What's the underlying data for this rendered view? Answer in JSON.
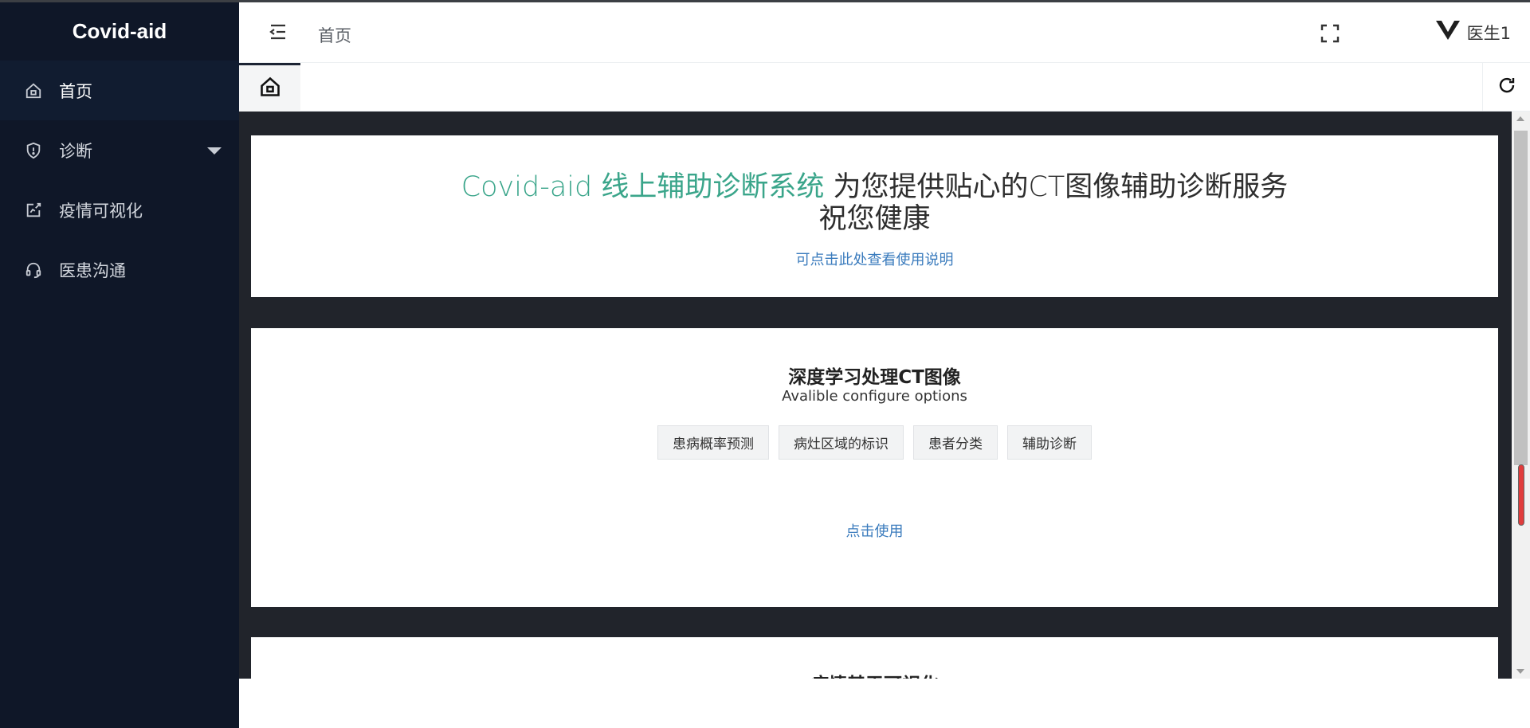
{
  "app": {
    "brand": "Covid-aid"
  },
  "sidebar": {
    "items": [
      {
        "label": "首页",
        "icon": "home-icon",
        "active": true
      },
      {
        "label": "诊断",
        "icon": "shield-icon",
        "expandable": true
      },
      {
        "label": "疫情可视化",
        "icon": "chart-edit-icon"
      },
      {
        "label": "医患沟通",
        "icon": "headset-icon"
      }
    ]
  },
  "header": {
    "title": "首页",
    "user_name": "医生1"
  },
  "tabs": {
    "home_icon": "home-icon",
    "refresh_icon": "refresh-icon"
  },
  "hero": {
    "accent_text": "Covid-aid 线上辅助诊断系统",
    "rest_text": " 为您提供贴心的CT图像辅助诊断服务",
    "line2": "祝您健康",
    "help_link": "可点击此处查看使用说明"
  },
  "dl_card": {
    "title": "深度学习处理CT图像",
    "subtitle": "Avalible configure options",
    "tags": [
      "患病概率预测",
      "病灶区域的标识",
      "患者分类",
      "辅助诊断"
    ],
    "use_link": "点击使用"
  },
  "next_card": {
    "title": "疫情基于可视化"
  },
  "colors": {
    "sidebar_bg": "#0f1728",
    "accent": "#3aa58a",
    "link": "#3a7bbd",
    "content_bg": "#21242b"
  }
}
